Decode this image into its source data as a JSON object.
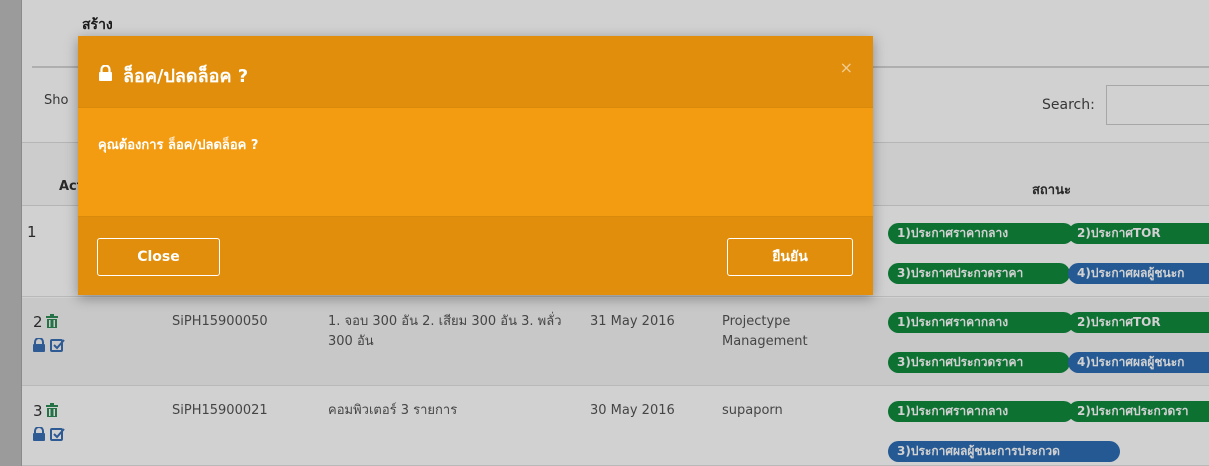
{
  "page": {
    "top_label": "สร้าง",
    "show_label": "Sho",
    "search_label": "Search:",
    "search_value": ""
  },
  "table": {
    "headers": {
      "action": "Act",
      "status": "สถานะ"
    },
    "rows": [
      {
        "number": "1",
        "code": "",
        "detail": "",
        "date": "",
        "owner": "",
        "badges": [
          {
            "label": "1)ประกาศราคากลาง",
            "color": "green"
          },
          {
            "label": "2)ประกาศTOR",
            "color": "green"
          },
          {
            "label": "3)ประกาศประกวดราคา",
            "color": "green"
          },
          {
            "label": "4)ประกาศผลผู้ชนะก",
            "color": "blue"
          }
        ]
      },
      {
        "number": "2",
        "code": "SiPH15900050",
        "detail": "1. จอบ 300 อัน 2. เสียม 300 อัน 3. พลั่ว 300 อัน",
        "date": "31 May 2016",
        "owner": "Projectype Management",
        "badges": [
          {
            "label": "1)ประกาศราคากลาง",
            "color": "green"
          },
          {
            "label": "2)ประกาศTOR",
            "color": "green"
          },
          {
            "label": "3)ประกาศประกวดราคา",
            "color": "green"
          },
          {
            "label": "4)ประกาศผลผู้ชนะก",
            "color": "blue"
          }
        ]
      },
      {
        "number": "3",
        "code": "SiPH15900021",
        "detail": "คอมพิวเตอร์ 3 รายการ",
        "date": "30 May 2016",
        "owner": "supaporn",
        "badges": [
          {
            "label": "1)ประกาศราคากลาง",
            "color": "green"
          },
          {
            "label": "2)ประกาศประกวดรา",
            "color": "green"
          },
          {
            "label": "3)ประกาศผลผู้ชนะการประกวด",
            "color": "blue"
          }
        ]
      }
    ]
  },
  "modal": {
    "title": "ล็อค/ปลดล็อค ?",
    "close_icon": "×",
    "body": "คุณต้องการ ล็อค/ปลดล็อค ?",
    "close_button": "Close",
    "confirm_button": "ยืนยัน"
  },
  "colors": {
    "modal_bg": "#f39c12",
    "modal_header": "#e08e0b",
    "badge_green": "#108a3e",
    "badge_blue": "#2d6db5"
  }
}
